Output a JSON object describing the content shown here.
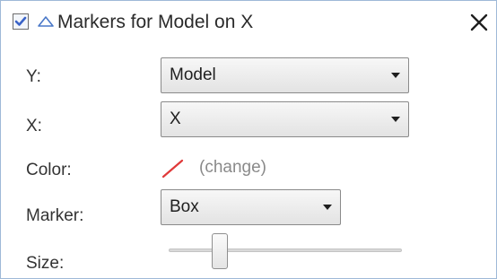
{
  "header": {
    "checked": true,
    "title": "Markers for Model on X"
  },
  "fields": {
    "y": {
      "label": "Y:",
      "value": "Model"
    },
    "x": {
      "label": "X:",
      "value": "X"
    },
    "color": {
      "label": "Color:",
      "swatch_color": "#e03a3a",
      "change_label": "(change)"
    },
    "marker": {
      "label": "Marker:",
      "value": "Box"
    },
    "size": {
      "label": "Size:",
      "slider_fraction": 0.2
    }
  },
  "icons": {
    "checkbox_check": "check-icon",
    "collapse": "triangle-up-icon",
    "close": "close-icon",
    "dropdown": "chevron-down-icon"
  },
  "colors": {
    "accent": "#3a63c8",
    "border": "#9fb9d8"
  }
}
